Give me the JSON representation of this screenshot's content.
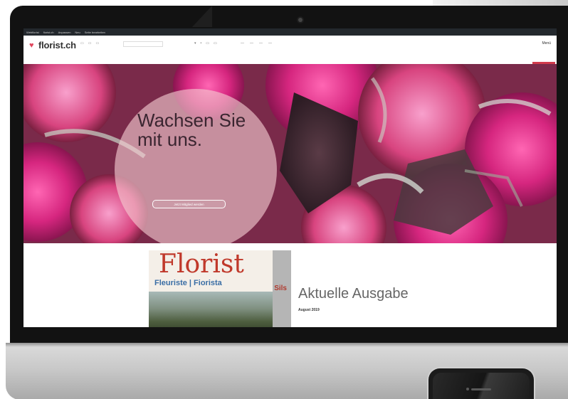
{
  "admin_bar": {
    "items": [
      "Webflorist",
      "florist.ch",
      "Anpassen",
      "Neu",
      "Seite bearbeiten"
    ],
    "right": ""
  },
  "header": {
    "logo_text": "florist.ch",
    "logo_icon": "heart-icon",
    "menu_label": "Menü",
    "cta_label": ""
  },
  "hero": {
    "title_line1": "Wachsen Sie",
    "title_line2": "mit uns.",
    "text": "",
    "button_label": "Jetzt Mitglied werden"
  },
  "magazine": {
    "cover_title": "Florist",
    "cover_subtitle": "Fleuriste | Fiorista",
    "cover_badge": "Sils",
    "heading": "Aktuelle Ausgabe",
    "date": "August 2019",
    "teaser": ""
  },
  "colors": {
    "accent": "#d13b4d",
    "admin_bar": "#23282d",
    "hero_overlay": "#f5cdd2"
  }
}
